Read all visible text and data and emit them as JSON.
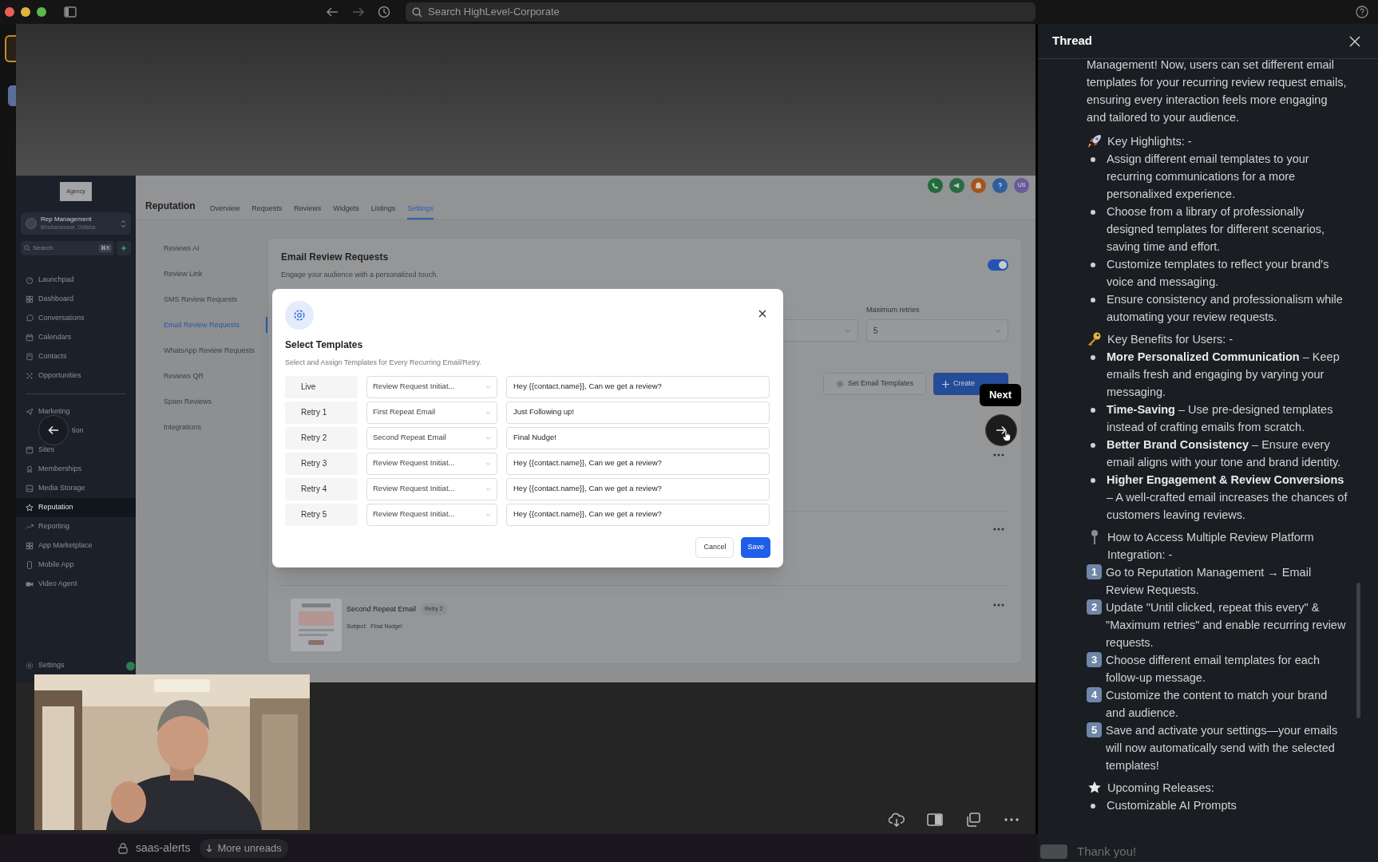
{
  "browser_bar": {
    "search_placeholder": "Search HighLevel-Corporate"
  },
  "app": {
    "logo_text": "Agency",
    "account": {
      "name": "Rep Management",
      "location": "Bhubaneswar, Odisha"
    },
    "sidebar_search": {
      "placeholder": "Search",
      "shortcut": "⌘K"
    },
    "nav_groups": [
      [
        {
          "label": "Launchpad",
          "selected": false,
          "covered": false
        },
        {
          "label": "Dashboard",
          "selected": false,
          "covered": false
        },
        {
          "label": "Conversations",
          "selected": false,
          "covered": false
        },
        {
          "label": "Calendars",
          "selected": false,
          "covered": false
        },
        {
          "label": "Contacts",
          "selected": false,
          "covered": false
        },
        {
          "label": "Opportunities",
          "selected": false,
          "covered": false
        }
      ],
      [
        {
          "label": "Marketing",
          "selected": false,
          "covered": false
        },
        {
          "label": "tion",
          "selected": false,
          "covered": true
        },
        {
          "label": "Sites",
          "selected": false,
          "covered": false
        },
        {
          "label": "Memberships",
          "selected": false,
          "covered": false
        },
        {
          "label": "Media Storage",
          "selected": false,
          "covered": false
        },
        {
          "label": "Reputation",
          "selected": true,
          "covered": false
        },
        {
          "label": "Reporting",
          "selected": false,
          "covered": false
        },
        {
          "label": "App Marketplace",
          "selected": false,
          "covered": false
        },
        {
          "label": "Mobile App",
          "selected": false,
          "covered": false
        },
        {
          "label": "Video Agent",
          "selected": false,
          "covered": false
        }
      ]
    ],
    "settings_label": "Settings",
    "header": {
      "title": "Reputation",
      "tabs": [
        {
          "label": "Overview",
          "selected": false
        },
        {
          "label": "Requests",
          "selected": false
        },
        {
          "label": "Reviews",
          "selected": false
        },
        {
          "label": "Widgets",
          "selected": false
        },
        {
          "label": "Listings",
          "selected": false
        },
        {
          "label": "Settings",
          "selected": true
        }
      ],
      "avatar": "US"
    },
    "settings_nav": [
      {
        "label": "Reviews AI",
        "selected": false
      },
      {
        "label": "Review Link",
        "selected": false
      },
      {
        "label": "SMS Review Requests",
        "selected": false
      },
      {
        "label": "Email Review Requests",
        "selected": true
      },
      {
        "label": "WhatsApp Review Requests",
        "selected": false
      },
      {
        "label": "Reviews QR",
        "selected": false
      },
      {
        "label": "Spam Reviews",
        "selected": false
      },
      {
        "label": "Integrations",
        "selected": false
      }
    ],
    "card": {
      "title": "Email Review Requests",
      "subtitle": "Engage your audience with a personalized touch.",
      "toggle": {
        "on": true
      },
      "retries": {
        "label": "Maximum retries",
        "value": "5"
      },
      "set_templates_button": "Set Email Templates",
      "create_button": "Create",
      "template": {
        "name": "Second Repeat Email",
        "badge": "Retry 2",
        "subject_label": "Subject:",
        "subject": "Final Nudge!"
      }
    },
    "modal": {
      "title": "Select Templates",
      "subtitle": "Select and Assign Templates for Every Recurring Email/Retry.",
      "rows": [
        {
          "label": "Live",
          "template": "Review Request Initiat...",
          "subject": "Hey {{contact.name}}, Can we get a review?"
        },
        {
          "label": "Retry 1",
          "template": "First Repeat Email",
          "subject": "Just Following up!"
        },
        {
          "label": "Retry 2",
          "template": "Second Repeat Email",
          "subject": "Final Nudge!"
        },
        {
          "label": "Retry 3",
          "template": "Review Request Initiat...",
          "subject": "Hey {{contact.name}}, Can we get a review?"
        },
        {
          "label": "Retry 4",
          "template": "Review Request Initiat...",
          "subject": "Hey {{contact.name}}, Can we get a review?"
        },
        {
          "label": "Retry 5",
          "template": "Review Request Initiat...",
          "subject": "Hey {{contact.name}}, Can we get a review?"
        }
      ],
      "cancel": "Cancel",
      "save": "Save"
    }
  },
  "tooltip": "Next",
  "thread": {
    "title": "Thread",
    "blocks": [
      {
        "kind": "paragraph",
        "text": "Management! Now, users can set different email templates for your recurring review request emails, ensuring every interaction feels more engaging and tailored to your audience."
      },
      {
        "kind": "heading",
        "text": "Key Highlights: -"
      },
      {
        "kind": "bullets",
        "items": [
          "Assign different email templates to your recurring communications for a more personalixed experience.",
          "Choose from a library of professionally designed templates for different scenarios, saving time and effort.",
          "Customize templates to reflect your brand's voice and messaging.",
          "Ensure consistency and professionalism while automating your review requests."
        ]
      },
      {
        "kind": "heading",
        "text": "Key Benefits for Users: -"
      },
      {
        "kind": "bullets",
        "items": [
          "**More Personalized Communication** – Keep emails fresh and engaging by varying your messaging.",
          "**Time-Saving** – Use pre-designed templates instead of crafting emails from scratch.",
          "**Better Brand Consistency** – Ensure every email aligns with your tone and brand identity.",
          "**Higher Engagement & Review Conversions** – A well-crafted email increases the chances of customers leaving reviews."
        ]
      },
      {
        "kind": "heading",
        "text": "How to Access Multiple Review Platform Integration: -"
      },
      {
        "kind": "steps",
        "items": [
          {
            "number": "1",
            "text": "Go to Reputation Management → Email Review Requests."
          },
          {
            "number": "2",
            "text": "Update \"Until clicked, repeat this every\" & \"Maximum retries\" and enable recurring review requests."
          },
          {
            "number": "3",
            "text": "Choose different email templates for each follow-up message."
          },
          {
            "number": "4",
            "text": "Customize the content to match your brand and audience."
          },
          {
            "number": "5",
            "text": "Save and activate your settings—your emails will now automatically send with the selected templates!"
          }
        ]
      },
      {
        "kind": "heading",
        "text": "Upcoming Releases:"
      },
      {
        "kind": "bullets",
        "items": [
          "Customizable AI Prompts"
        ]
      }
    ],
    "reply": "Thank you!"
  },
  "slack_bar": {
    "channel": "saas-alerts",
    "more": "More unreads"
  }
}
